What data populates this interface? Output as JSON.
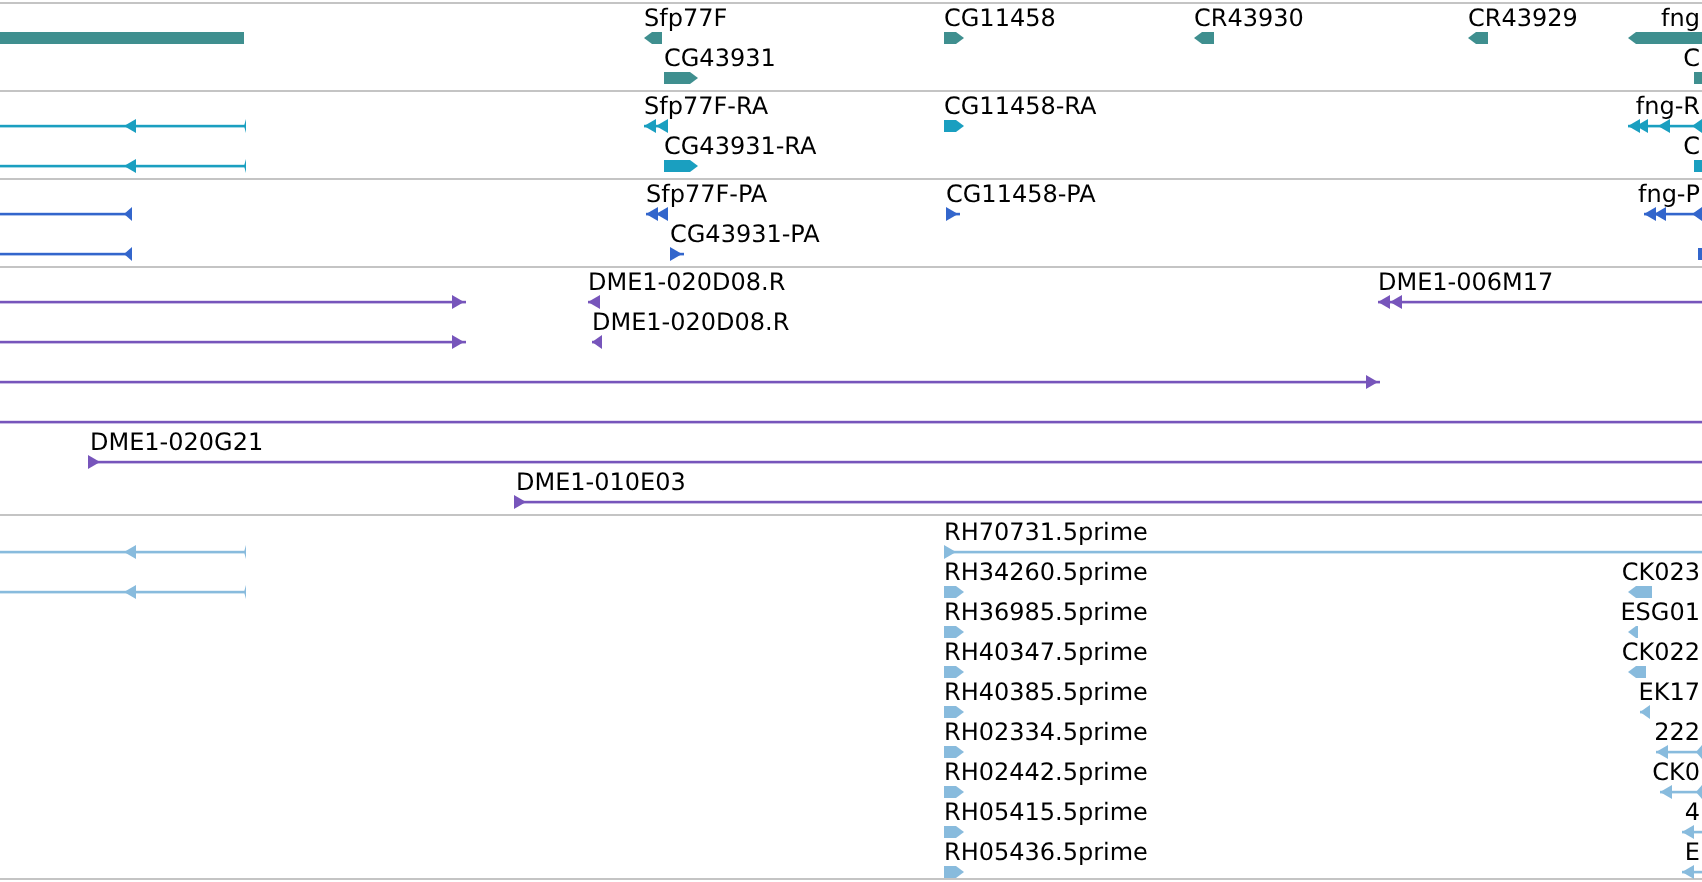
{
  "tracks": [
    {
      "color": "#3f8f8f",
      "features": [
        {
          "kind": "bar"
        },
        {
          "kind": "bar",
          "label": "Sfp77F",
          "forward": false
        },
        {
          "kind": "bar",
          "label": "CG43931",
          "forward": true
        },
        {
          "kind": "bar",
          "label": "CG11458",
          "forward": true
        },
        {
          "kind": "bar",
          "label": "CR43930",
          "forward": false
        },
        {
          "kind": "bar",
          "label": "CR43929",
          "forward": false
        },
        {
          "kind": "bar",
          "label": "fng",
          "forward": false
        },
        {
          "kind": "bar",
          "label": "C"
        }
      ]
    },
    {
      "color": "#1a9fc0",
      "features": [
        {
          "kind": "line",
          "forward": false
        },
        {
          "kind": "line",
          "forward": false
        },
        {
          "kind": "line",
          "label": "Sfp77F-RA",
          "forward": false
        },
        {
          "kind": "bar",
          "label": "CG43931-RA",
          "forward": true
        },
        {
          "kind": "bar",
          "label": "CG11458-RA",
          "forward": true
        },
        {
          "kind": "line",
          "label": "fng-R",
          "forward": false
        },
        {
          "kind": "bar",
          "label": "C"
        }
      ]
    },
    {
      "color": "#3366cc",
      "features": [
        {
          "kind": "line",
          "forward": false
        },
        {
          "kind": "line",
          "forward": false
        },
        {
          "kind": "line",
          "label": "Sfp77F-PA",
          "forward": false
        },
        {
          "kind": "line",
          "label": "CG43931-PA",
          "forward": true
        },
        {
          "kind": "line",
          "label": "CG11458-PA",
          "forward": true
        },
        {
          "kind": "line",
          "label": "fng-P",
          "forward": false
        },
        {
          "kind": "bar"
        }
      ]
    },
    {
      "color": "#7755bb",
      "features": [
        {
          "kind": "line",
          "forward": true
        },
        {
          "kind": "line",
          "label": "DME1-020D08.R",
          "forward": false
        },
        {
          "kind": "line",
          "label": "DME1-006M17",
          "forward": false
        },
        {
          "kind": "line",
          "forward": true
        },
        {
          "kind": "line",
          "label": "DME1-020D08.R",
          "forward": false
        },
        {
          "kind": "line",
          "forward": true
        },
        {
          "kind": "line"
        },
        {
          "kind": "line",
          "label": "DME1-020G21",
          "forward": true
        },
        {
          "kind": "line",
          "label": "DME1-010E03",
          "forward": true
        }
      ]
    },
    {
      "color": "#88bbdd",
      "features": [
        {
          "kind": "line",
          "forward": false
        },
        {
          "kind": "line",
          "forward": false
        },
        {
          "kind": "line",
          "label": "RH70731.5prime",
          "forward": true
        },
        {
          "kind": "bar",
          "label": "RH34260.5prime",
          "forward": true
        },
        {
          "kind": "bar",
          "label": "RH36985.5prime",
          "forward": true
        },
        {
          "kind": "bar",
          "label": "RH40347.5prime",
          "forward": true
        },
        {
          "kind": "bar",
          "label": "RH40385.5prime",
          "forward": true
        },
        {
          "kind": "bar",
          "label": "RH02334.5prime",
          "forward": true
        },
        {
          "kind": "bar",
          "label": "RH02442.5prime",
          "forward": true
        },
        {
          "kind": "bar",
          "label": "RH05415.5prime",
          "forward": true
        },
        {
          "kind": "bar",
          "label": "RH05436.5prime",
          "forward": true
        },
        {
          "kind": "bar",
          "label": "CK023",
          "forward": false
        },
        {
          "kind": "bar",
          "label": "ESG01",
          "forward": false
        },
        {
          "kind": "bar",
          "label": "CK022",
          "forward": false
        },
        {
          "kind": "line",
          "label": "EK17",
          "forward": false
        },
        {
          "kind": "line",
          "label": "222",
          "forward": false
        },
        {
          "kind": "line",
          "label": "CK0",
          "forward": false
        },
        {
          "kind": "line",
          "label": "4",
          "forward": false
        },
        {
          "kind": "line",
          "label": "E",
          "forward": false
        }
      ]
    }
  ]
}
